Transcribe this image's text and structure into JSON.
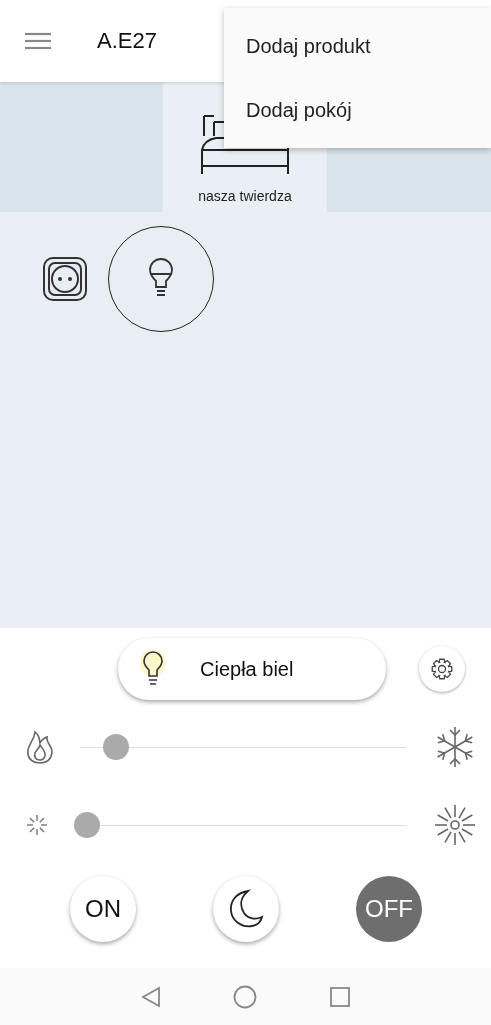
{
  "app_bar": {
    "title": "A.E27"
  },
  "menu": {
    "items": [
      {
        "label": "Dodaj produkt"
      },
      {
        "label": "Dodaj pokój"
      }
    ]
  },
  "rooms": [
    {
      "name": "nasza twierdza",
      "selected": true
    }
  ],
  "devices": [
    {
      "kind": "socket",
      "selected": false
    },
    {
      "kind": "bulb",
      "selected": true
    }
  ],
  "color_mode": {
    "label": "Ciepła biel"
  },
  "sliders": [
    {
      "kind": "temperature",
      "level": 0.11
    },
    {
      "kind": "brightness",
      "level": 0.04
    }
  ],
  "power_buttons": [
    {
      "kind": "on",
      "label": "ON",
      "selected": false
    },
    {
      "kind": "night",
      "selected": false
    },
    {
      "kind": "off",
      "label": "OFF",
      "selected": true
    }
  ]
}
